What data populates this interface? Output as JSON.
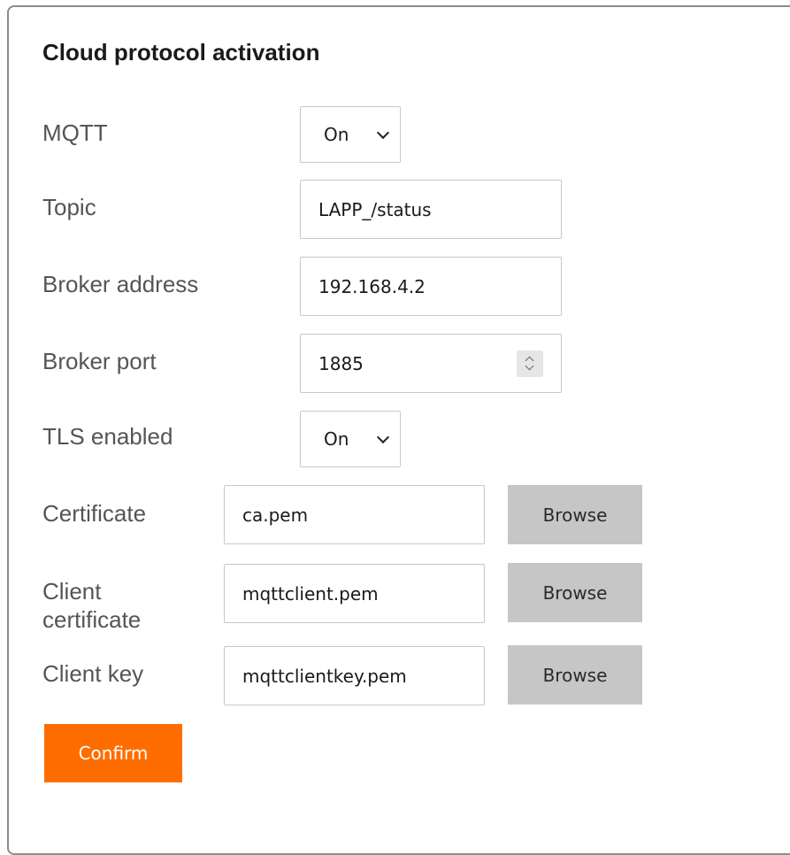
{
  "form": {
    "title": "Cloud protocol activation",
    "mqtt": {
      "label": "MQTT",
      "value": "On"
    },
    "topic": {
      "label": "Topic",
      "value": "LAPP_/status"
    },
    "broker_address": {
      "label": "Broker address",
      "value": "192.168.4.2"
    },
    "broker_port": {
      "label": "Broker port",
      "value": "1885"
    },
    "tls": {
      "label": "TLS enabled",
      "value": "On"
    },
    "certificate": {
      "label": "Certificate",
      "value": "ca.pem",
      "button": "Browse"
    },
    "client_certificate": {
      "label_line1": "Client",
      "label_line2": "certificate",
      "value": "mqttclient.pem",
      "button": "Browse"
    },
    "client_key": {
      "label": "Client key",
      "value": "mqttclientkey.pem",
      "button": "Browse"
    },
    "confirm_label": "Confirm"
  },
  "colors": {
    "confirm": "#ff6d00",
    "browse": "#c6c6c6",
    "label": "#555555",
    "border": "#8c8c8c"
  }
}
